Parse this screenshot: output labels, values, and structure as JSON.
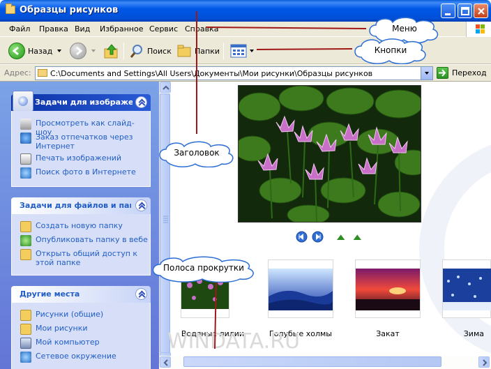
{
  "window": {
    "title": "Образцы рисунков"
  },
  "menu": {
    "items": [
      "Файл",
      "Правка",
      "Вид",
      "Избранное",
      "Сервис",
      "Справка"
    ]
  },
  "toolbar": {
    "back": "Назад",
    "search": "Поиск",
    "folders": "Папки"
  },
  "address": {
    "label": "Адрес:",
    "path": "C:\\Documents and Settings\\All Users\\Документы\\Мои рисунки\\Образцы рисунков",
    "go": "Переход"
  },
  "panels": [
    {
      "title": "Задачи для изображений",
      "tasks": [
        "Просмотреть как слайд-шоу",
        "Заказ отпечатков через Интернет",
        "Печать изображений",
        "Поиск фото в Интернете"
      ]
    },
    {
      "title": "Задачи для файлов и папок",
      "tasks": [
        "Создать новую папку",
        "Опубликовать папку в вебе",
        "Открыть общий доступ к этой папке"
      ]
    },
    {
      "title": "Другие места",
      "tasks": [
        "Рисунки (общие)",
        "Мои рисунки",
        "Мой компьютер",
        "Сетевое окружение"
      ]
    }
  ],
  "thumbnails": [
    "Водяные лилии",
    "Голубые холмы",
    "Закат",
    "Зима"
  ],
  "callouts": {
    "menu": "Меню",
    "buttons": "Кнопки",
    "title": "Заголовок",
    "scrollbar": "Полоса прокрутки"
  },
  "watermark": "WINDATA.RU",
  "colors": {
    "titlebar": "#0058e6",
    "taskpane": "#6f8ce0",
    "link": "#215dc6",
    "annotation_line": "#a01818"
  }
}
